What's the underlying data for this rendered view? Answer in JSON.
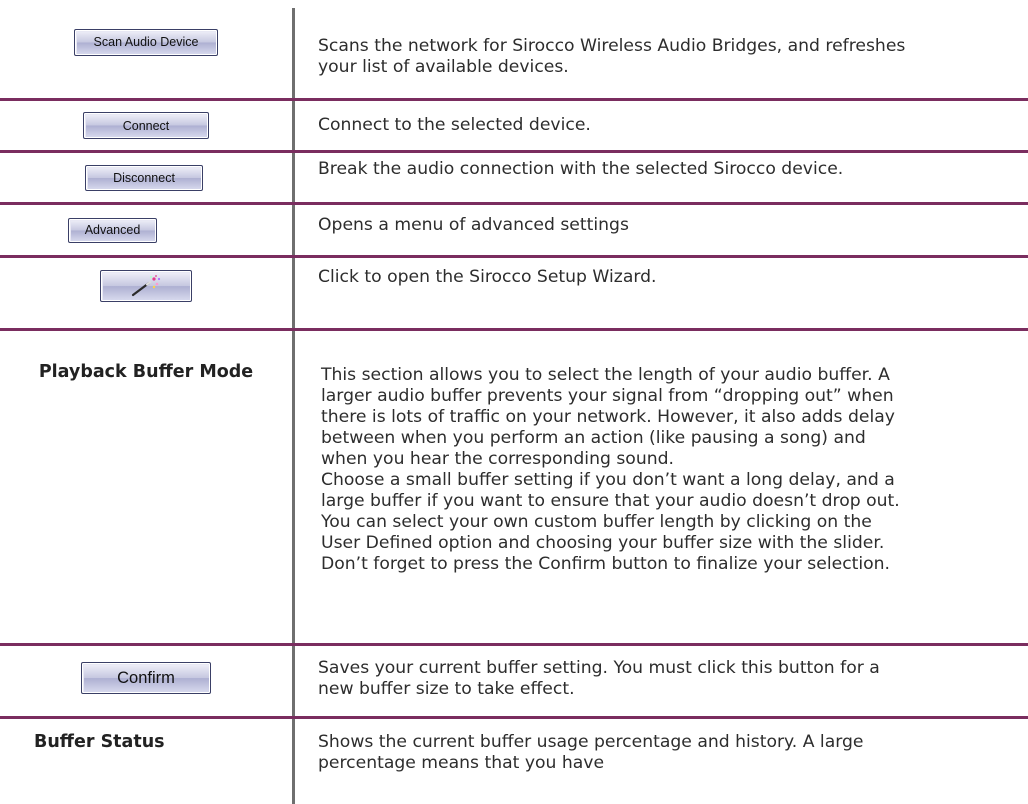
{
  "rows": {
    "scan": {
      "button_label": "Scan Audio Device",
      "description": [
        "Scans the network for Sirocco Wireless Audio Bridges, and refreshes",
        "your list of available devices."
      ]
    },
    "connect": {
      "button_label": "Connect",
      "description": [
        "Connect to the selected device."
      ]
    },
    "disconnect": {
      "button_label": "Disconnect",
      "description": [
        "Break the audio connection with the selected Sirocco device."
      ]
    },
    "advanced": {
      "button_label": "Advanced",
      "description": [
        "Opens a menu of advanced settings"
      ]
    },
    "wizard": {
      "button_icon": "magic-wand-icon",
      "description": [
        "Click to open the Sirocco Setup Wizard."
      ]
    },
    "playback_buffer_mode": {
      "label": "Playback Buffer Mode",
      "description": [
        "This section allows you to select the length of your audio buffer. A",
        "larger audio buffer prevents your signal from “dropping out” when",
        "there is lots of traffic on your network. However, it also adds delay",
        "between when you perform an action (like pausing a song) and",
        "when you hear the corresponding sound.",
        "Choose a small buffer setting if you don’t want a long delay, and a",
        "large buffer if you want to ensure that your audio doesn’t drop out.",
        "You can select your own custom buffer length by clicking on the",
        "User Defined option and choosing your buffer size with the slider.",
        "Don’t forget to press the Confirm button to finalize your selection."
      ]
    },
    "confirm": {
      "button_label": "Confirm",
      "description": [
        "Saves your current buffer setting. You must click this button for a",
        "new buffer size to take effect."
      ]
    },
    "buffer_status": {
      "label": "Buffer Status",
      "description": [
        "Shows the current buffer usage percentage and history. A large",
        "percentage means that you have"
      ]
    }
  },
  "colors": {
    "divider": "#7a2d5f",
    "column_rule": "#6f6f6f",
    "button_border": "#3a3f66"
  }
}
